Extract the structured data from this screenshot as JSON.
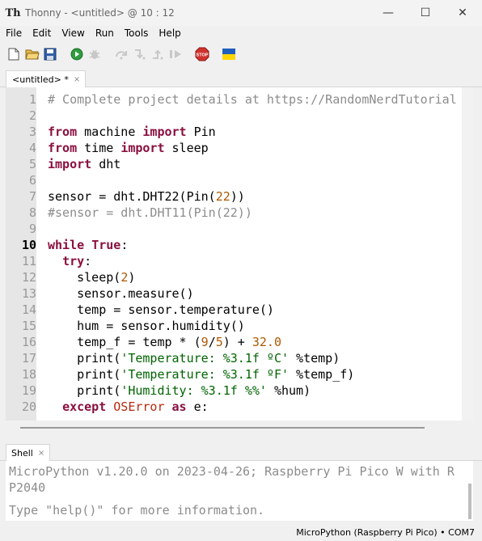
{
  "window": {
    "title": "Thonny  -  <untitled>  @  10 : 12",
    "minimize": "—",
    "maximize": "☐",
    "close": "✕"
  },
  "menu": [
    "File",
    "Edit",
    "View",
    "Run",
    "Tools",
    "Help"
  ],
  "toolbar": {
    "icons": [
      "new-file-icon",
      "open-file-icon",
      "save-icon",
      "run-icon",
      "debug-icon",
      "step-over-icon",
      "step-into-icon",
      "step-out-icon",
      "resume-icon",
      "stop-icon",
      "ukraine-flag-icon"
    ],
    "stop_label": "STOP"
  },
  "editor": {
    "tab_label": "<untitled> *",
    "tab_close": "×",
    "line_numbers": [
      "1",
      "2",
      "3",
      "4",
      "5",
      "6",
      "7",
      "8",
      "9",
      "10",
      "11",
      "12",
      "13",
      "14",
      "15",
      "16",
      "17",
      "18",
      "19",
      "20"
    ],
    "current_line": "10"
  },
  "shell": {
    "tab_label": "Shell",
    "tab_close": "×",
    "line1": "MicroPython v1.20.0 on 2023-04-26; Raspberry Pi Pico W with R",
    "line2": "P2040",
    "line3": "Type \"help()\" for more information."
  },
  "status": {
    "interpreter": "MicroPython (Raspberry Pi Pico)  •  COM7"
  },
  "colors": {
    "keyword": "#8a0f3f",
    "number": "#b05800",
    "string": "#006400",
    "comment": "#8c8c8c",
    "class_name": "#b52a0e"
  }
}
